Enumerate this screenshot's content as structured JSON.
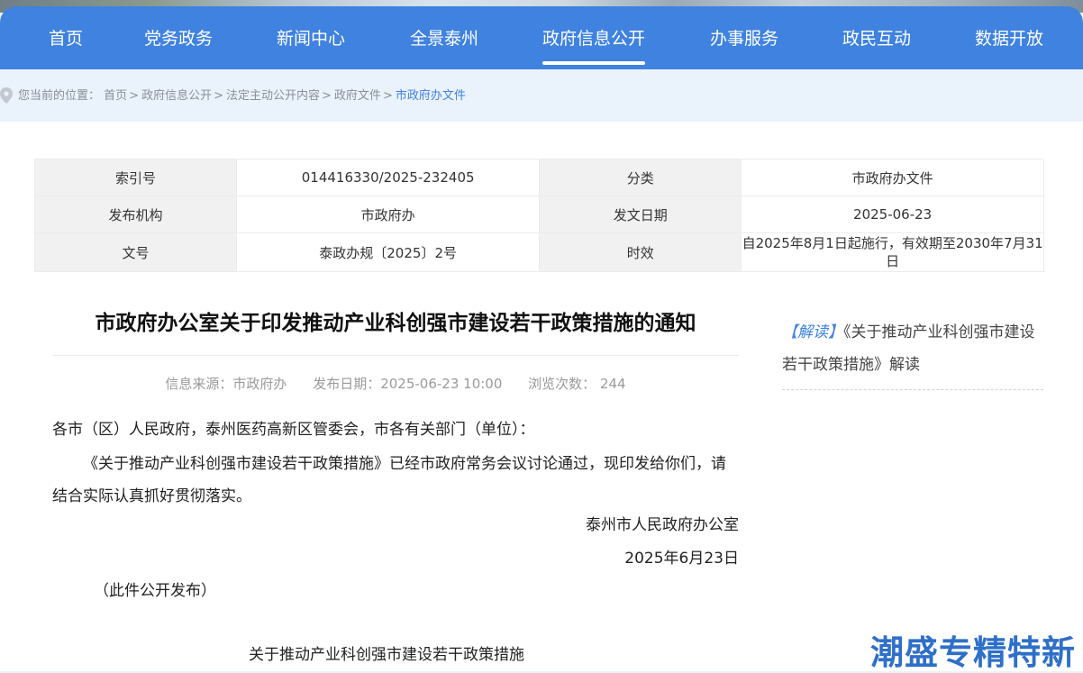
{
  "nav": {
    "items": [
      {
        "label": "首页"
      },
      {
        "label": "党务政务"
      },
      {
        "label": "新闻中心"
      },
      {
        "label": "全景泰州"
      },
      {
        "label": "政府信息公开",
        "active": true
      },
      {
        "label": "办事服务"
      },
      {
        "label": "政民互动"
      },
      {
        "label": "数据开放"
      }
    ]
  },
  "breadcrumb": {
    "prefix": "您当前的位置：",
    "items": [
      "首页",
      "政府信息公开",
      "法定主动公开内容",
      "政府文件",
      "市政府办文件"
    ],
    "separator": ">"
  },
  "meta_table": {
    "rows": [
      {
        "k1": "索引号",
        "v1": "014416330/2025-232405",
        "k2": "分类",
        "v2": "市政府办文件"
      },
      {
        "k1": "发布机构",
        "v1": "市政府办",
        "k2": "发文日期",
        "v2": "2025-06-23"
      },
      {
        "k1": "文号",
        "v1": "泰政办规〔2025〕2号",
        "k2": "时效",
        "v2": "自2025年8月1日起施行，有效期至2030年7月31日"
      }
    ]
  },
  "article": {
    "title": "市政府办公室关于印发推动产业科创强市建设若干政策措施的通知",
    "source": "信息来源：市政府办",
    "publish_date": "发布日期：2025-06-23 10:00",
    "views": "浏览次数： 244",
    "salutation": "各市（区）人民政府，泰州医药高新区管委会，市各有关部门（单位）：",
    "main_paragraph": "《关于推动产业科创强市建设若干政策措施》已经市政府常务会议讨论通过，现印发给你们，请结合实际认真抓好贯彻落实。",
    "issuer": "泰州市人民政府办公室",
    "sign_date": "2025年6月23日",
    "note": "（此件公开发布）",
    "attachment_title": "关于推动产业科创强市建设若干政策措施"
  },
  "sidebar": {
    "tag": "【解读】",
    "link_text": "《关于推动产业科创强市建设若干政策措施》解读"
  },
  "watermark": {
    "text": "潮盛专精特新"
  },
  "colors": {
    "primary": "#3f82e0",
    "page_bg": "#eaf2fc"
  }
}
